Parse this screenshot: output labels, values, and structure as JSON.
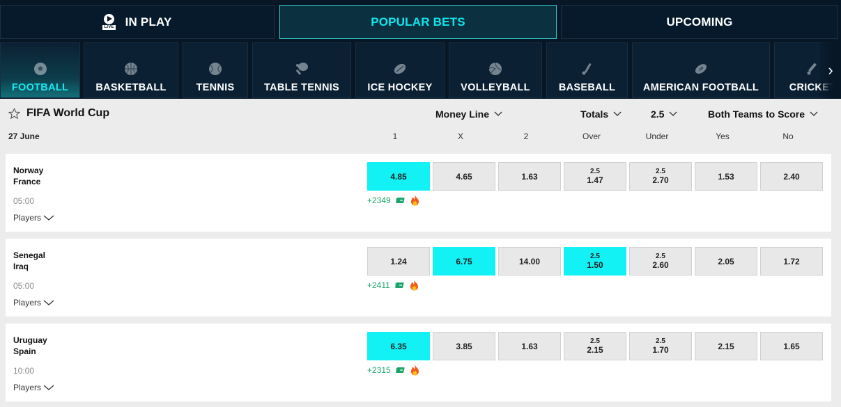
{
  "top_tabs": [
    {
      "label": "IN PLAY",
      "live_badge": "LIVE"
    },
    {
      "label": "POPULAR BETS"
    },
    {
      "label": "UPCOMING"
    }
  ],
  "sports": [
    {
      "label": "FOOTBALL",
      "icon": "football-icon"
    },
    {
      "label": "BASKETBALL",
      "icon": "basketball-icon"
    },
    {
      "label": "TENNIS",
      "icon": "tennis-icon"
    },
    {
      "label": "TABLE TENNIS",
      "icon": "table-tennis-icon"
    },
    {
      "label": "ICE HOCKEY",
      "icon": "ice-hockey-icon"
    },
    {
      "label": "VOLLEYBALL",
      "icon": "volleyball-icon"
    },
    {
      "label": "BASEBALL",
      "icon": "baseball-icon"
    },
    {
      "label": "AMERICAN FOOTBALL",
      "icon": "american-football-icon"
    },
    {
      "label": "CRICKET",
      "icon": "cricket-icon"
    }
  ],
  "competition": {
    "title": "FIFA World Cup"
  },
  "markets": {
    "money_line": "Money Line",
    "totals": "Totals",
    "totals_line": "2.5",
    "btts": "Both Teams to Score"
  },
  "date": "27 June",
  "columns": [
    "1",
    "X",
    "2",
    "Over",
    "Under",
    "Yes",
    "No"
  ],
  "events": [
    {
      "home": "Norway",
      "away": "France",
      "time": "05:00",
      "players_label": "Players",
      "more_markets": "+2349",
      "odds": [
        {
          "price": "4.85",
          "highlight": true
        },
        {
          "price": "4.65"
        },
        {
          "price": "1.63"
        },
        {
          "line": "2.5",
          "price": "1.47"
        },
        {
          "line": "2.5",
          "price": "2.70"
        },
        {
          "price": "1.53"
        },
        {
          "price": "2.40"
        }
      ]
    },
    {
      "home": "Senegal",
      "away": "Iraq",
      "time": "05:00",
      "players_label": "Players",
      "more_markets": "+2411",
      "odds": [
        {
          "price": "1.24"
        },
        {
          "price": "6.75",
          "highlight": true
        },
        {
          "price": "14.00"
        },
        {
          "line": "2.5",
          "price": "1.50",
          "highlight": true
        },
        {
          "line": "2.5",
          "price": "2.60"
        },
        {
          "price": "2.05"
        },
        {
          "price": "1.72"
        }
      ]
    },
    {
      "home": "Uruguay",
      "away": "Spain",
      "time": "10:00",
      "players_label": "Players",
      "more_markets": "+2315",
      "odds": [
        {
          "price": "6.35",
          "highlight": true
        },
        {
          "price": "3.85"
        },
        {
          "price": "1.63"
        },
        {
          "line": "2.5",
          "price": "2.15"
        },
        {
          "line": "2.5",
          "price": "1.70"
        },
        {
          "price": "2.15"
        },
        {
          "price": "1.65"
        }
      ]
    }
  ],
  "colors": {
    "accent": "#12f2f4",
    "background": "#071726",
    "positive": "#1aa66b"
  }
}
